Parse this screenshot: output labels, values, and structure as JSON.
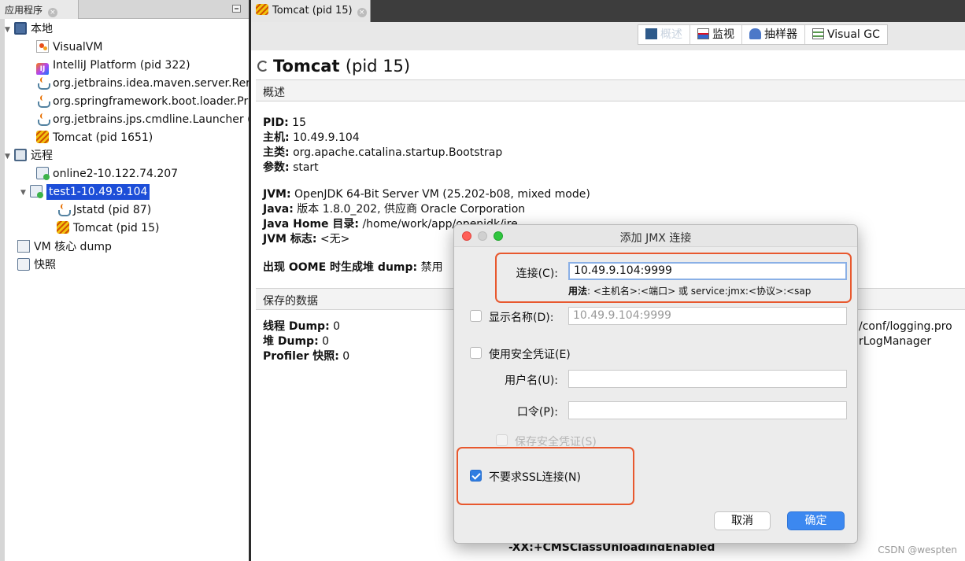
{
  "left_panel": {
    "tab_label": "应用程序",
    "tree": {
      "local_label": "本地",
      "local_items": [
        {
          "label": "VisualVM"
        },
        {
          "label": "IntelliJ Platform (pid 322)"
        },
        {
          "label": "org.jetbrains.idea.maven.server.Rer"
        },
        {
          "label": "org.springframework.boot.loader.Pr"
        },
        {
          "label": "org.jetbrains.jps.cmdline.Launcher ("
        },
        {
          "label": "Tomcat (pid 1651)"
        }
      ],
      "remote_label": "远程",
      "remote_hosts": [
        {
          "label": "online2-10.122.74.207"
        },
        {
          "label": "test1-10.49.9.104"
        }
      ],
      "remote_children": [
        {
          "label": "Jstatd (pid 87)"
        },
        {
          "label": "Tomcat (pid 15)"
        }
      ],
      "vm_dump_label": "VM 核心 dump",
      "snapshot_label": "快照"
    }
  },
  "main": {
    "tab_label": "Tomcat (pid 15)",
    "subtabs": [
      "概述",
      "监视",
      "抽样器",
      "Visual GC"
    ],
    "title_name": "Tomcat",
    "title_pid": "(pid 15)",
    "overview_section": "概述",
    "info": {
      "pid_label": "PID:",
      "pid_value": "15",
      "host_label": "主机:",
      "host_value": "10.49.9.104",
      "mainclass_label": "主类:",
      "mainclass_value": "org.apache.catalina.startup.Bootstrap",
      "args_label": "参数:",
      "args_value": "start",
      "jvm_label": "JVM:",
      "jvm_value": "OpenJDK 64-Bit Server VM (25.202-b08, mixed mode)",
      "java_label": "Java:",
      "java_value": "版本 1.8.0_202, 供应商 Oracle Corporation",
      "javahome_label": "Java Home 目录:",
      "javahome_value": "/home/work/app/openjdk/jre",
      "jvmflags_label": "JVM 标志:",
      "jvmflags_value": "<无>",
      "oome_label": "出现 OOME 时生成堆 dump:",
      "oome_value": "禁用"
    },
    "saved_section": "保存的数据",
    "saved": {
      "thread_dump_label": "线程 Dump:",
      "thread_dump_value": "0",
      "heap_dump_label": "堆 Dump:",
      "heap_dump_value": "0",
      "profiler_label": "Profiler 快照:",
      "profiler_value": "0"
    },
    "right_clip_1": "/conf/logging.pro",
    "right_clip_2": "rLogManager",
    "bottom_clip": "-XX:+CMSClassUnloadingEnabled",
    "watermark": "CSDN @wespten"
  },
  "dialog": {
    "title": "添加 JMX 连接",
    "connection_label": "连接(C):",
    "connection_value": "10.49.9.104:9999",
    "usage_label": "用法",
    "usage_text": ": <主机名>:<端口> 或 service:jmx:<协议>:<sap",
    "display_name_label": "显示名称(D):",
    "display_name_value": "10.49.9.104:9999",
    "use_credentials_label": "使用安全凭证(E)",
    "username_label": "用户名(U):",
    "password_label": "口令(P):",
    "save_credentials_label": "保存安全凭证(S)",
    "no_ssl_label": "不要求SSL连接(N)",
    "cancel_label": "取消",
    "ok_label": "确定"
  },
  "colors": {
    "accent": "#3c88f0",
    "selection": "#1d4ed8",
    "highlight": "#e8582e"
  }
}
